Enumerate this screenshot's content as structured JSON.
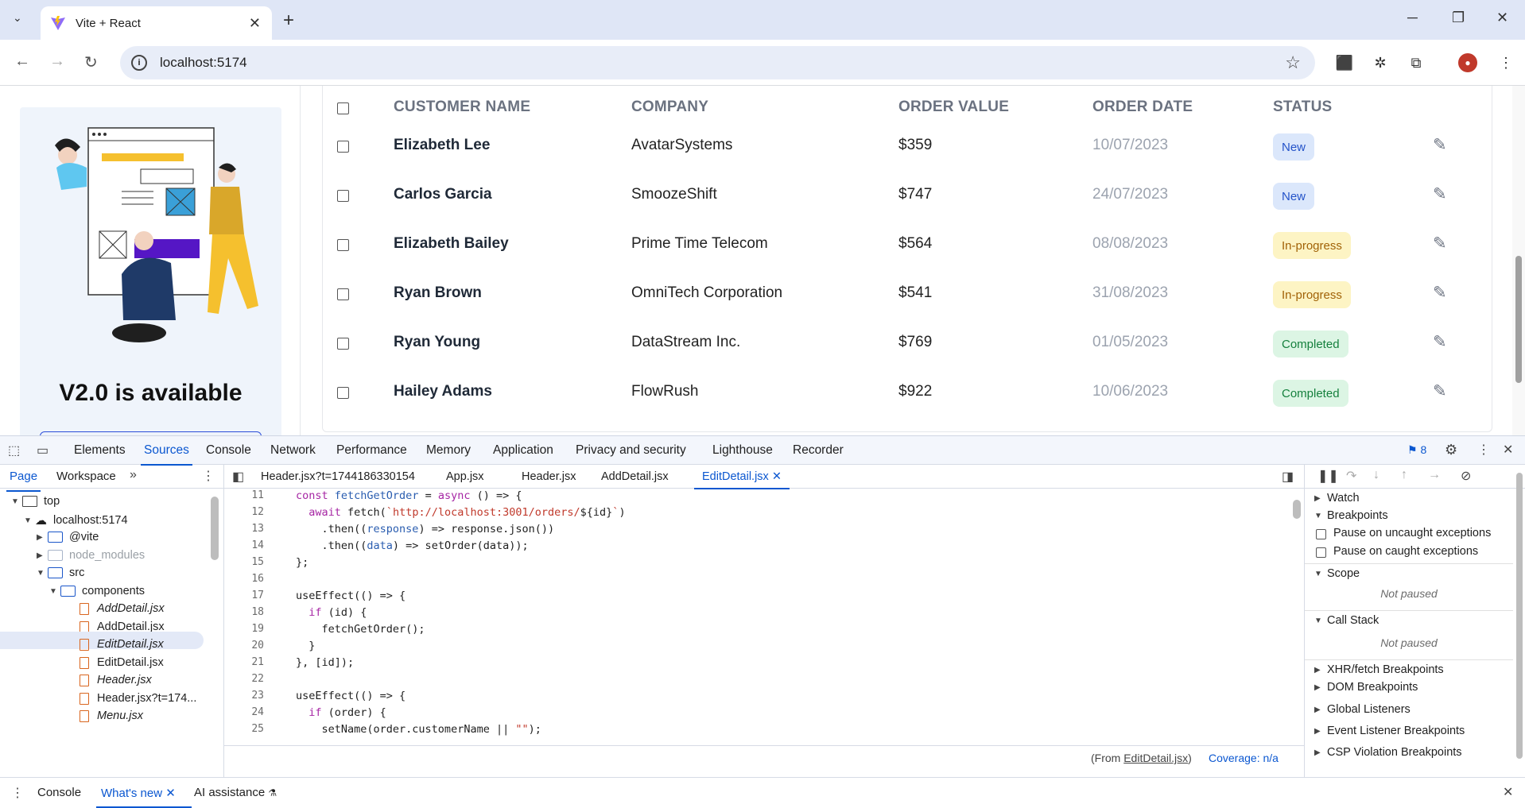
{
  "browser": {
    "tab_title": "Vite + React",
    "url": "localhost:5174"
  },
  "sidebar": {
    "promo_title": "V2.0 is available"
  },
  "orders_table": {
    "headers": [
      "CUSTOMER NAME",
      "COMPANY",
      "ORDER VALUE",
      "ORDER DATE",
      "STATUS"
    ],
    "rows": [
      {
        "name": "Elizabeth Lee",
        "company": "AvatarSystems",
        "value": "$359",
        "date": "10/07/2023",
        "status": "New"
      },
      {
        "name": "Carlos Garcia",
        "company": "SmoozeShift",
        "value": "$747",
        "date": "24/07/2023",
        "status": "New"
      },
      {
        "name": "Elizabeth Bailey",
        "company": "Prime Time Telecom",
        "value": "$564",
        "date": "08/08/2023",
        "status": "In-progress"
      },
      {
        "name": "Ryan Brown",
        "company": "OmniTech Corporation",
        "value": "$541",
        "date": "31/08/2023",
        "status": "In-progress"
      },
      {
        "name": "Ryan Young",
        "company": "DataStream Inc.",
        "value": "$769",
        "date": "01/05/2023",
        "status": "Completed"
      },
      {
        "name": "Hailey Adams",
        "company": "FlowRush",
        "value": "$922",
        "date": "10/06/2023",
        "status": "Completed"
      }
    ]
  },
  "devtools": {
    "main_tabs": [
      "Elements",
      "Sources",
      "Console",
      "Network",
      "Performance",
      "Memory",
      "Application",
      "Privacy and security",
      "Lighthouse",
      "Recorder"
    ],
    "active_tab": "Sources",
    "issues_count": "8",
    "nav_tabs": [
      "Page",
      "Workspace"
    ],
    "file_tree": {
      "top": "top",
      "host": "localhost:5174",
      "vite": "@vite",
      "node_modules": "node_modules",
      "src": "src",
      "components": "components",
      "files": [
        "AddDetail.jsx",
        "AddDetail.jsx",
        "EditDetail.jsx",
        "EditDetail.jsx",
        "Header.jsx",
        "Header.jsx?t=174...",
        "Menu.jsx"
      ]
    },
    "editor_tabs": [
      "Header.jsx?t=1744186330154",
      "App.jsx",
      "Header.jsx",
      "AddDetail.jsx",
      "EditDetail.jsx"
    ],
    "code": {
      "line_numbers": [
        "11",
        "12",
        "13",
        "14",
        "15",
        "16",
        "17",
        "18",
        "19",
        "20",
        "21",
        "22",
        "23",
        "24",
        "25"
      ],
      "line_11_a": "const ",
      "line_11_b": "fetchGetOrder",
      "line_11_c": " = ",
      "line_11_d": "async",
      "line_11_e": " () => {",
      "line_12_a": "  ",
      "line_12_b": "await",
      "line_12_c": " fetch(",
      "line_12_d": "`http://localhost:3001/orders/",
      "line_12_e": "${id}",
      "line_12_f": "`",
      "line_12_g": ")",
      "line_13_a": "    .then((",
      "line_13_b": "response",
      "line_13_c": ") => response.json())",
      "line_14_a": "    .then((",
      "line_14_b": "data",
      "line_14_c": ") => setOrder(data));",
      "line_15": "};",
      "line_17": "useEffect(() => {",
      "line_18_a": "  ",
      "line_18_b": "if",
      "line_18_c": " (id) {",
      "line_19": "    fetchGetOrder();",
      "line_20": "  }",
      "line_21": "}, [id]);",
      "line_23": "useEffect(() => {",
      "line_24_a": "  ",
      "line_24_b": "if",
      "line_24_c": " (order) {",
      "line_25_a": "    setName(order.customerName || ",
      "line_25_b": "\"\"",
      "line_25_c": ");"
    },
    "status_from_prefix": "(From ",
    "status_from_file": "EditDetail.jsx",
    "status_from_suffix": ")",
    "coverage": "Coverage: n/a",
    "debugger": {
      "watch": "Watch",
      "breakpoints": "Breakpoints",
      "pause_uncaught": "Pause on uncaught exceptions",
      "pause_caught": "Pause on caught exceptions",
      "scope": "Scope",
      "not_paused": "Not paused",
      "call_stack": "Call Stack",
      "xhr": "XHR/fetch Breakpoints",
      "dom": "DOM Breakpoints",
      "global": "Global Listeners",
      "event": "Event Listener Breakpoints",
      "csp": "CSP Violation Breakpoints"
    },
    "drawer_tabs": [
      "Console",
      "What's new",
      "AI assistance"
    ]
  }
}
